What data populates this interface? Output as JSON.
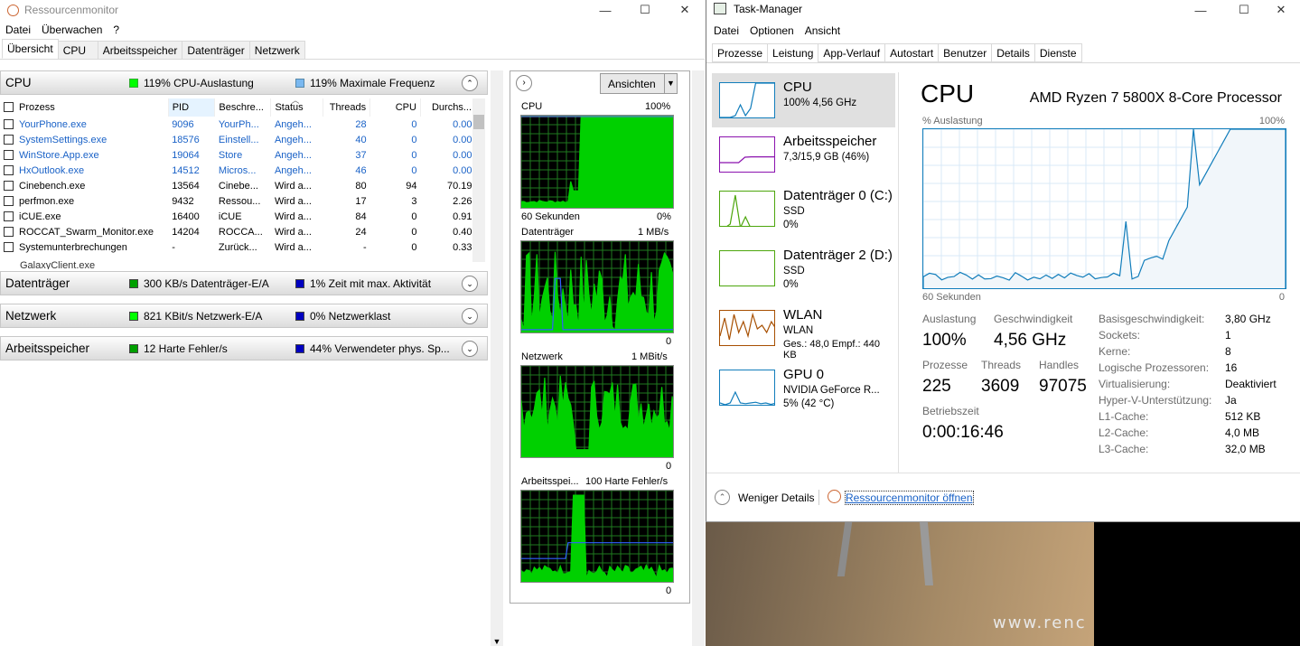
{
  "rm": {
    "title": "Ressourcenmonitor",
    "menu": [
      "Datei",
      "Überwachen",
      "?"
    ],
    "tabs": [
      "Übersicht",
      "CPU",
      "Arbeitsspeicher",
      "Datenträger",
      "Netzwerk"
    ],
    "cpu": {
      "name": "CPU",
      "m1": "119% CPU-Auslastung",
      "m2": "119% Maximale Frequenz"
    },
    "columns": [
      "Prozess",
      "PID",
      "Beschre...",
      "Status",
      "Threads",
      "CPU",
      "Durchs..."
    ],
    "rows": [
      {
        "p": "YourPhone.exe",
        "pid": "9096",
        "d": "YourPh...",
        "s": "Angeh...",
        "t": "28",
        "c": "0",
        "a": "0.00",
        "blue": true
      },
      {
        "p": "SystemSettings.exe",
        "pid": "18576",
        "d": "Einstell...",
        "s": "Angeh...",
        "t": "40",
        "c": "0",
        "a": "0.00",
        "blue": true
      },
      {
        "p": "WinStore.App.exe",
        "pid": "19064",
        "d": "Store",
        "s": "Angeh...",
        "t": "37",
        "c": "0",
        "a": "0.00",
        "blue": true
      },
      {
        "p": "HxOutlook.exe",
        "pid": "14512",
        "d": "Micros...",
        "s": "Angeh...",
        "t": "46",
        "c": "0",
        "a": "0.00",
        "blue": true
      },
      {
        "p": "Cinebench.exe",
        "pid": "13564",
        "d": "Cinebe...",
        "s": "Wird a...",
        "t": "80",
        "c": "94",
        "a": "70.19",
        "blue": false
      },
      {
        "p": "perfmon.exe",
        "pid": "9432",
        "d": "Ressou...",
        "s": "Wird a...",
        "t": "17",
        "c": "3",
        "a": "2.26",
        "blue": false
      },
      {
        "p": "iCUE.exe",
        "pid": "16400",
        "d": "iCUE",
        "s": "Wird a...",
        "t": "84",
        "c": "0",
        "a": "0.91",
        "blue": false
      },
      {
        "p": "ROCCAT_Swarm_Monitor.exe",
        "pid": "14204",
        "d": "ROCCA...",
        "s": "Wird a...",
        "t": "24",
        "c": "0",
        "a": "0.40",
        "blue": false
      },
      {
        "p": "Systemunterbrechungen",
        "pid": "-",
        "d": "Zurück...",
        "s": "Wird a...",
        "t": "-",
        "c": "0",
        "a": "0.33",
        "blue": false
      }
    ],
    "disk": {
      "name": "Datenträger",
      "m1": "300 KB/s Datenträger-E/A",
      "m2": "1% Zeit mit max. Aktivität"
    },
    "net": {
      "name": "Netzwerk",
      "m1": "821 KBit/s Netzwerk-E/A",
      "m2": "0% Netzwerklast"
    },
    "mem": {
      "name": "Arbeitsspeicher",
      "m1": "12 Harte Fehler/s",
      "m2": "44% Verwendeter phys. Sp..."
    },
    "views_btn": "Ansichten",
    "graphs": {
      "cpu": {
        "label": "CPU",
        "max": "100%",
        "foot_l": "60 Sekunden",
        "foot_r": "0%"
      },
      "disk": {
        "label": "Datenträger",
        "max": "1 MB/s",
        "zero": "0"
      },
      "net": {
        "label": "Netzwerk",
        "max": "1 MBit/s",
        "zero": "0"
      },
      "mem": {
        "label": "Arbeitsspei...",
        "max": "100 Harte Fehler/s",
        "zero": "0"
      }
    }
  },
  "tm": {
    "title": "Task-Manager",
    "menu": [
      "Datei",
      "Optionen",
      "Ansicht"
    ],
    "tabs": [
      "Prozesse",
      "Leistung",
      "App-Verlauf",
      "Autostart",
      "Benutzer",
      "Details",
      "Dienste"
    ],
    "side": [
      {
        "t1": "CPU",
        "t2": "100% 4,56 GHz",
        "t3": ""
      },
      {
        "t1": "Arbeitsspeicher",
        "t2": "7,3/15,9 GB (46%)",
        "t3": ""
      },
      {
        "t1": "Datenträger 0 (C:)",
        "t2": "SSD",
        "t3": "0%"
      },
      {
        "t1": "Datenträger 2 (D:)",
        "t2": "SSD",
        "t3": "0%"
      },
      {
        "t1": "WLAN",
        "t2": "WLAN",
        "t3": "Ges.: 48,0  Empf.: 440 KB"
      },
      {
        "t1": "GPU 0",
        "t2": "NVIDIA GeForce R...",
        "t3": "5% (42 °C)"
      }
    ],
    "heading": "CPU",
    "processor": "AMD Ryzen 7 5800X 8-Core Processor",
    "graph_label": "% Auslastung",
    "graph_max": "100%",
    "graph_foot_l": "60 Sekunden",
    "graph_foot_r": "0",
    "stats": {
      "auslastung_l": "Auslastung",
      "auslastung_v": "100%",
      "speed_l": "Geschwindigkeit",
      "speed_v": "4,56 GHz",
      "proc_l": "Prozesse",
      "proc_v": "225",
      "threads_l": "Threads",
      "threads_v": "3609",
      "handles_l": "Handles",
      "handles_v": "97075",
      "uptime_l": "Betriebszeit",
      "uptime_v": "0:00:16:46"
    },
    "kv": [
      [
        "Basisgeschwindigkeit:",
        "3,80 GHz"
      ],
      [
        "Sockets:",
        "1"
      ],
      [
        "Kerne:",
        "8"
      ],
      [
        "Logische Prozessoren:",
        "16"
      ],
      [
        "Virtualisierung:",
        "Deaktiviert"
      ],
      [
        "Hyper-V-Unterstützung:",
        "Ja"
      ],
      [
        "L1-Cache:",
        "512 KB"
      ],
      [
        "L2-Cache:",
        "4,0 MB"
      ],
      [
        "L3-Cache:",
        "32,0 MB"
      ]
    ],
    "less": "Weniger Details",
    "open_rm": "Ressourcenmonitor öffnen"
  },
  "bg_text": "www.renc",
  "colors": {
    "green": "#00ff00",
    "blue": "#2457f5",
    "tm_cpu": "#117dbb",
    "tm_mem": "#8b12ae",
    "tm_disk": "#4da60c",
    "tm_net": "#a74f01"
  }
}
